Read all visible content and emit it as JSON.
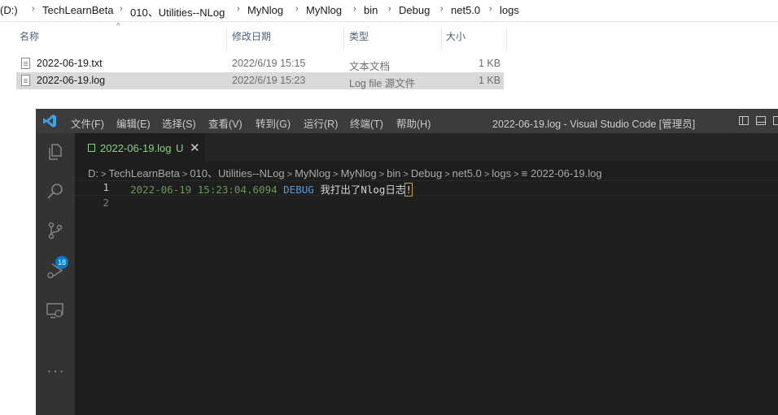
{
  "explorer": {
    "breadcrumb": [
      " (D:)",
      "TechLearnBeta",
      "010、Utilities--NLog",
      "MyNlog",
      "MyNlog",
      "bin",
      "Debug",
      "net5.0",
      "logs"
    ],
    "columns": {
      "name": "名称",
      "modified": "修改日期",
      "type": "类型",
      "size": "大小"
    },
    "files": [
      {
        "name": "2022-06-19.txt",
        "modified": "2022/6/19 15:15",
        "type": "文本文档",
        "size": "1 KB",
        "selected": false
      },
      {
        "name": "2022-06-19.log",
        "modified": "2022/6/19 15:23",
        "type": "Log file 源文件",
        "size": "1 KB",
        "selected": true
      }
    ]
  },
  "vscode": {
    "menu": [
      "文件(F)",
      "编辑(E)",
      "选择(S)",
      "查看(V)",
      "转到(G)",
      "运行(R)",
      "终端(T)",
      "帮助(H)"
    ],
    "window_title": "2022-06-19.log - Visual Studio Code [管理员]",
    "tab": {
      "name": "2022-06-19.log",
      "status": "U",
      "close": "✕"
    },
    "scm_badge": "18",
    "more": "···",
    "breadcrumb": [
      "D:",
      "TechLearnBeta",
      "010、Utilities--NLog",
      "MyNlog",
      "MyNlog",
      "bin",
      "Debug",
      "net5.0",
      "logs"
    ],
    "breadcrumb_file": "2022-06-19.log",
    "line_numbers": [
      "1",
      "2"
    ],
    "log_line": {
      "date": "2022-06-19 15:23:04.6094",
      "level": "DEBUG",
      "message": "我打出了Nlog日志",
      "last_char": "!"
    },
    "colors": {
      "accent": "#007acc",
      "untracked": "#89d185",
      "date": "#6a9955",
      "level": "#569cd6"
    }
  }
}
